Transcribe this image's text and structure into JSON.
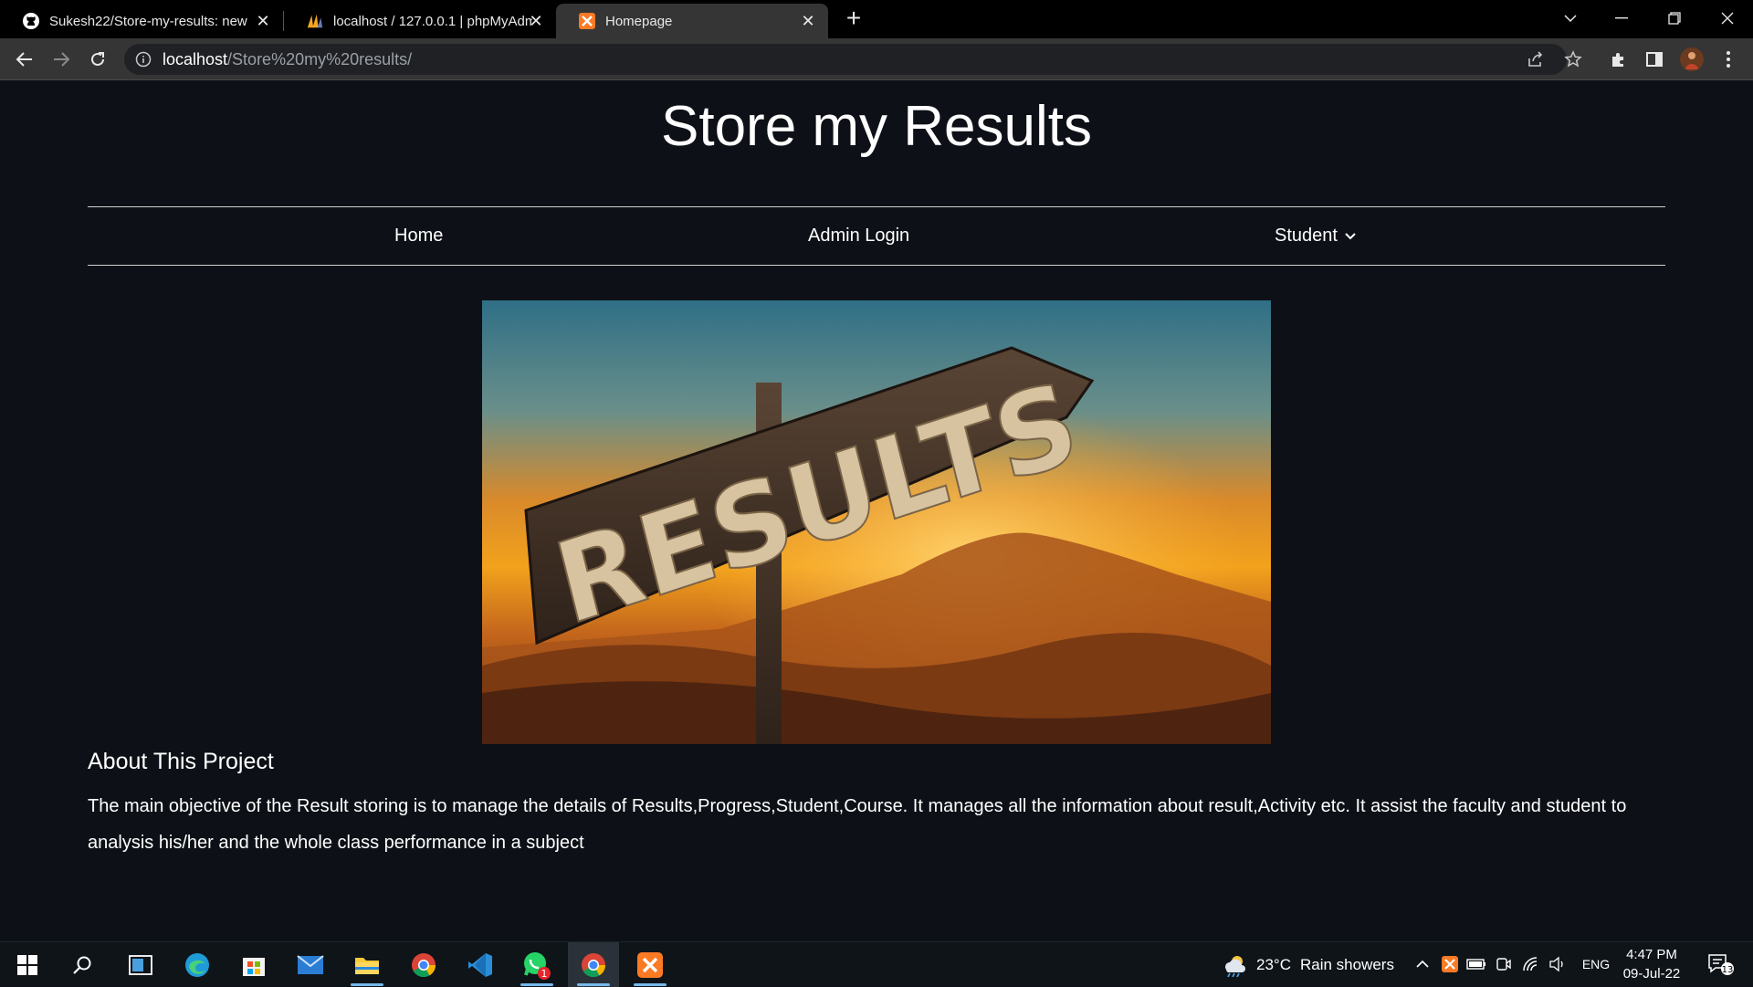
{
  "browser": {
    "tabs": [
      {
        "title": "Sukesh22/Store-my-results: new",
        "favicon": "github-icon"
      },
      {
        "title": "localhost / 127.0.0.1 | phpMyAdm",
        "favicon": "phpmyadmin-icon"
      },
      {
        "title": "Homepage",
        "favicon": "xampp-icon"
      }
    ],
    "address": {
      "host": "localhost",
      "path": "/Store%20my%20results/"
    }
  },
  "page": {
    "title": "Store my Results",
    "nav": {
      "home": "Home",
      "admin": "Admin Login",
      "student": "Student"
    },
    "hero": {
      "sign_text": "RESULTS"
    },
    "about": {
      "heading": "About This Project",
      "body": "The main objective of the Result storing is to manage the details of Results,Progress,Student,Course. It manages all the information about result,Activity etc. It assist the faculty and student to analysis his/her and the whole class performance in a subject"
    }
  },
  "taskbar": {
    "weather": {
      "temp": "23°C",
      "desc": "Rain showers"
    },
    "lang": "ENG",
    "time": "4:47 PM",
    "date": "09-Jul-22",
    "whatsapp_badge": "1",
    "notification_count": "13"
  },
  "colors": {
    "page_bg": "#0d1117",
    "tab_active": "#353535",
    "taskbar": "#0f1419",
    "xampp": "#fb7a24"
  }
}
